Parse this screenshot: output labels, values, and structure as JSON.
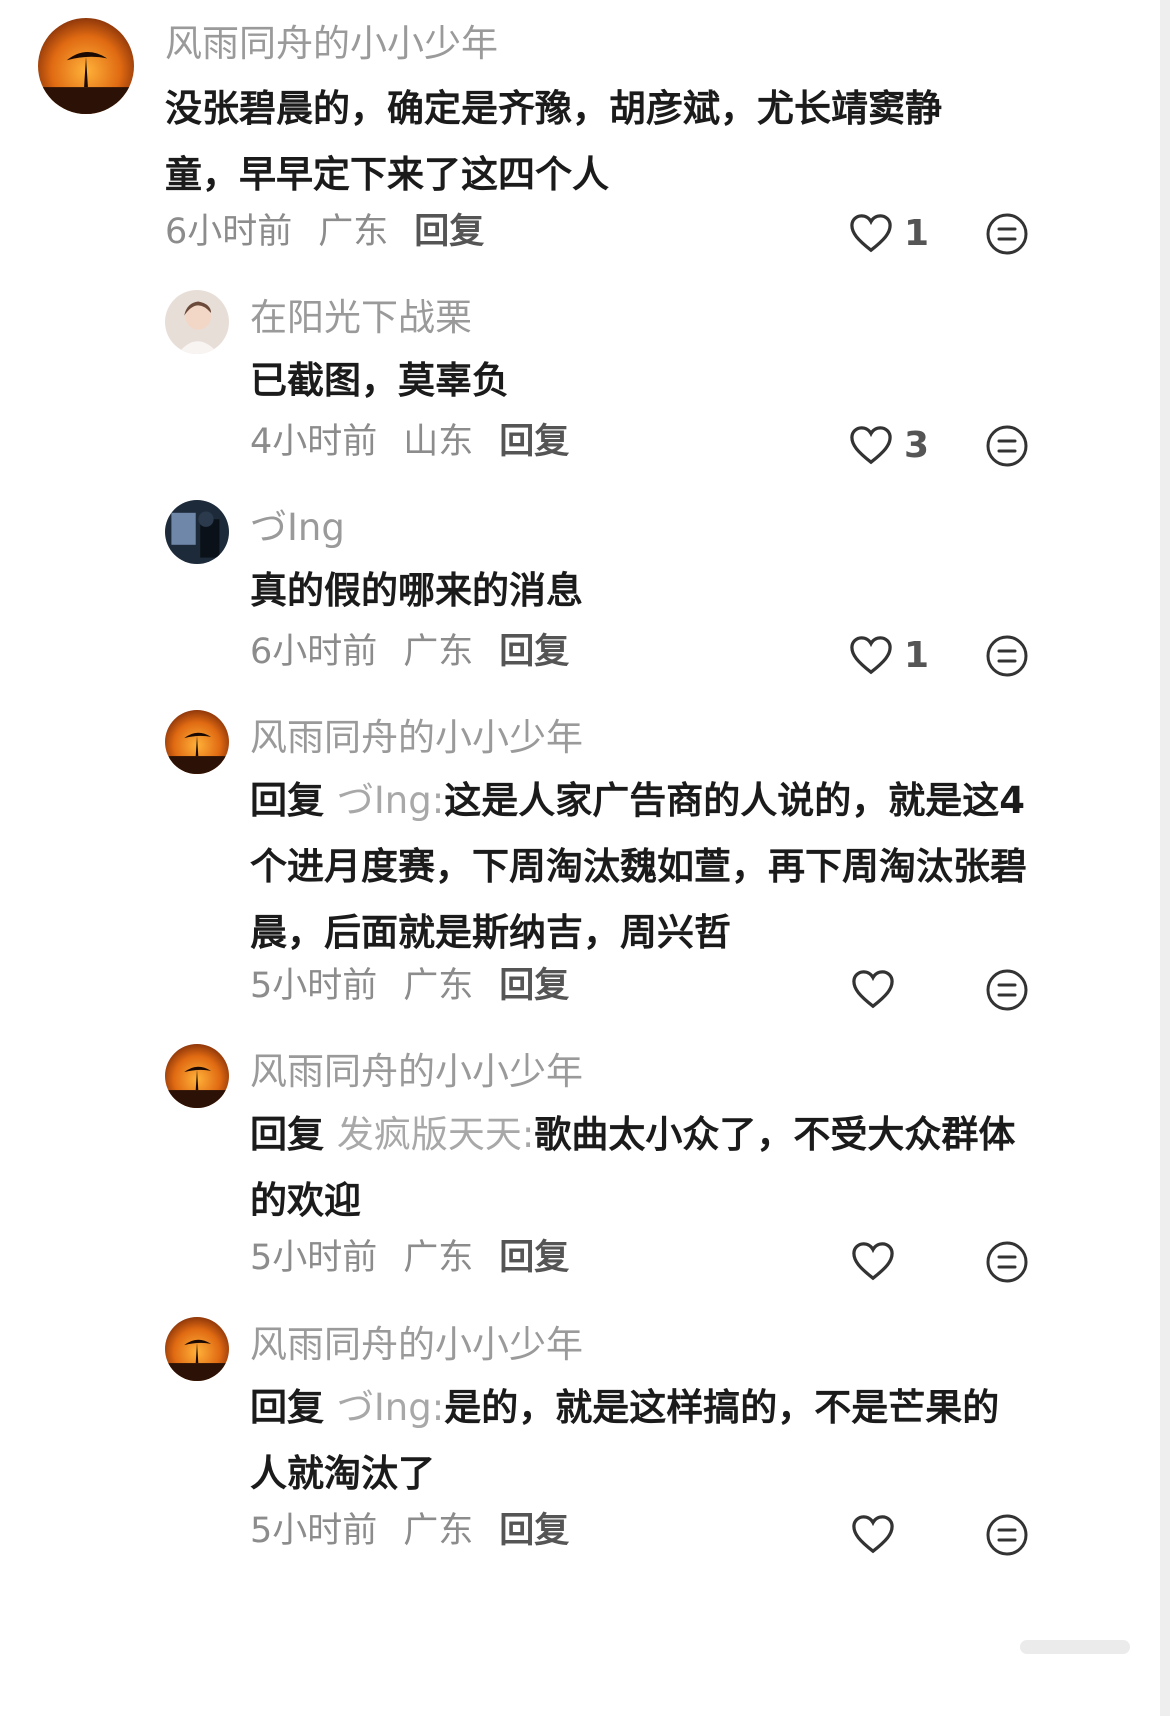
{
  "comments": [
    {
      "user": "风雨同舟的小小少年",
      "avatar_icon": "sunset-tree-avatar",
      "text": "没张碧晨的，确定是齐豫，胡彦斌，尤长靖窦静童，早早定下来了这四个人",
      "reply_prefix": "",
      "mention": "",
      "time": "6小时前",
      "location": "广东",
      "reply": "回复",
      "likes": "1"
    },
    {
      "user": "在阳光下战栗",
      "avatar_icon": "person-avatar",
      "text": "已截图，莫辜负",
      "reply_prefix": "",
      "mention": "",
      "time": "4小时前",
      "location": "山东",
      "reply": "回复",
      "likes": "3"
    },
    {
      "user": "づIng",
      "avatar_icon": "dark-photo-avatar",
      "text": "真的假的哪来的消息",
      "reply_prefix": "",
      "mention": "",
      "time": "6小时前",
      "location": "广东",
      "reply": "回复",
      "likes": "1"
    },
    {
      "user": "风雨同舟的小小少年",
      "avatar_icon": "sunset-tree-avatar",
      "text": "这是人家广告商的人说的，就是这4个进月度赛，下周淘汰魏如萱，再下周淘汰张碧晨，后面就是斯纳吉，周兴哲",
      "reply_prefix": "回复",
      "mention": "づIng:",
      "time": "5小时前",
      "location": "广东",
      "reply": "回复",
      "likes": ""
    },
    {
      "user": "风雨同舟的小小少年",
      "avatar_icon": "sunset-tree-avatar",
      "text": "歌曲太小众了，不受大众群体的欢迎",
      "reply_prefix": "回复",
      "mention": "发疯版天天:",
      "time": "5小时前",
      "location": "广东",
      "reply": "回复",
      "likes": ""
    },
    {
      "user": "风雨同舟的小小少年",
      "avatar_icon": "sunset-tree-avatar",
      "text": "是的，就是这样搞的，不是芒果的人就淘汰了",
      "reply_prefix": "回复",
      "mention": "づIng:",
      "time": "5小时前",
      "location": "广东",
      "reply": "回复",
      "likes": ""
    }
  ]
}
